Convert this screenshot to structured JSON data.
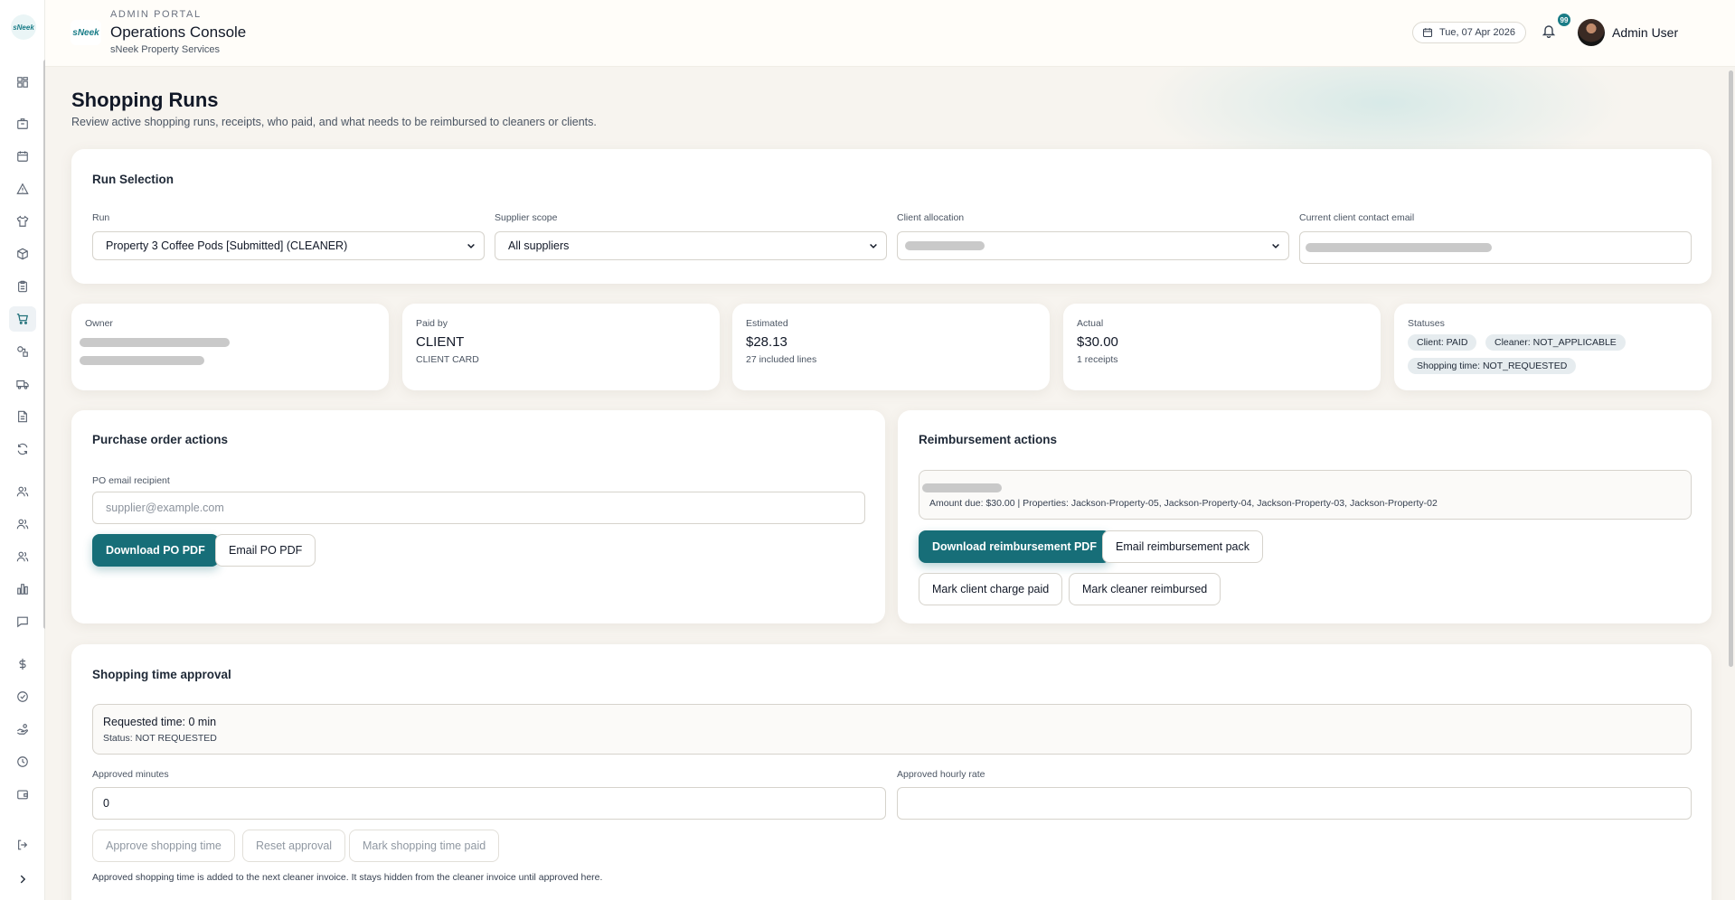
{
  "rail": {
    "logo_text": "sNeek",
    "items": [
      {
        "name": "dashboard",
        "icon": "grid-icon"
      },
      {
        "name": "properties",
        "icon": "building-icon"
      },
      {
        "name": "calendar",
        "icon": "calendar-icon"
      },
      {
        "name": "issues",
        "icon": "alert-triangle-icon"
      },
      {
        "name": "laundry",
        "icon": "shirt-icon"
      },
      {
        "name": "inventory",
        "icon": "box-icon"
      },
      {
        "name": "checklists",
        "icon": "clipboard-icon"
      },
      {
        "name": "shopping",
        "icon": "cart-icon"
      },
      {
        "name": "workflows",
        "icon": "shapes-icon"
      },
      {
        "name": "deliveries",
        "icon": "truck-icon"
      },
      {
        "name": "invoices",
        "icon": "document-icon"
      },
      {
        "name": "sync",
        "icon": "refresh-icon"
      },
      {
        "name": "users",
        "icon": "users-icon"
      },
      {
        "name": "cleaners",
        "icon": "team-icon"
      },
      {
        "name": "clients",
        "icon": "people-icon"
      },
      {
        "name": "reports",
        "icon": "bar-chart-icon"
      },
      {
        "name": "messages",
        "icon": "message-icon"
      },
      {
        "name": "finance",
        "icon": "dollar-icon"
      },
      {
        "name": "approvals",
        "icon": "check-circle-icon"
      },
      {
        "name": "pay",
        "icon": "hand-coins-icon"
      },
      {
        "name": "time",
        "icon": "clock-icon"
      },
      {
        "name": "wallet",
        "icon": "wallet-icon"
      },
      {
        "name": "logout",
        "icon": "logout-icon"
      },
      {
        "name": "expand",
        "icon": "chevron-right-icon"
      }
    ]
  },
  "header": {
    "brand_logo_text": "sNeek",
    "kicker": "ADMIN PORTAL",
    "title": "Operations Console",
    "subtitle": "sNeek Property Services",
    "date": "Tue, 07 Apr 2026",
    "notification_count": "99",
    "user_name": "Admin User"
  },
  "page": {
    "title": "Shopping Runs",
    "description": "Review active shopping runs, receipts, who paid, and what needs to be reimbursed to cleaners or clients."
  },
  "run_selection": {
    "title": "Run Selection",
    "run_label": "Run",
    "run_value": "Property 3 Coffee Pods [Submitted] (CLEANER)",
    "supplier_label": "Supplier scope",
    "supplier_value": "All suppliers",
    "client_label": "Client allocation",
    "email_label": "Current client contact email"
  },
  "stats": {
    "owner_label": "Owner",
    "paid_by_label": "Paid by",
    "paid_by_value": "CLIENT",
    "paid_by_sub": "CLIENT CARD",
    "estimated_label": "Estimated",
    "estimated_value": "$28.13",
    "estimated_sub": "27 included lines",
    "actual_label": "Actual",
    "actual_value": "$30.00",
    "actual_sub": "1 receipts",
    "statuses_label": "Statuses",
    "status_client": "Client: PAID",
    "status_cleaner": "Cleaner: NOT_APPLICABLE",
    "status_shopping_time": "Shopping time: NOT_REQUESTED"
  },
  "purchase_order": {
    "title": "Purchase order actions",
    "recipient_label": "PO email recipient",
    "recipient_placeholder": "supplier@example.com",
    "download_label": "Download PO PDF",
    "email_label": "Email PO PDF"
  },
  "reimbursement": {
    "title": "Reimbursement actions",
    "summary": "Amount due: $30.00 | Properties: Jackson-Property-05, Jackson-Property-04, Jackson-Property-03, Jackson-Property-02",
    "download_label": "Download reimbursement PDF",
    "email_pack_label": "Email reimbursement pack",
    "mark_client_paid_label": "Mark client charge paid",
    "mark_cleaner_reimbursed_label": "Mark cleaner reimbursed"
  },
  "shopping_time": {
    "title": "Shopping time approval",
    "requested": "Requested time: 0 min",
    "status": "Status: NOT REQUESTED",
    "approved_minutes_label": "Approved minutes",
    "approved_minutes_value": "0",
    "approved_rate_label": "Approved hourly rate",
    "approve_label": "Approve shopping time",
    "reset_label": "Reset approval",
    "mark_paid_label": "Mark shopping time paid",
    "note": "Approved shopping time is added to the next cleaner invoice. It stays hidden from the cleaner invoice until approved here."
  },
  "colors": {
    "accent": "#176e78",
    "page_bg": "#f7f4ef",
    "card_bg": "#ffffff",
    "pill_bg": "#e6ecef"
  }
}
